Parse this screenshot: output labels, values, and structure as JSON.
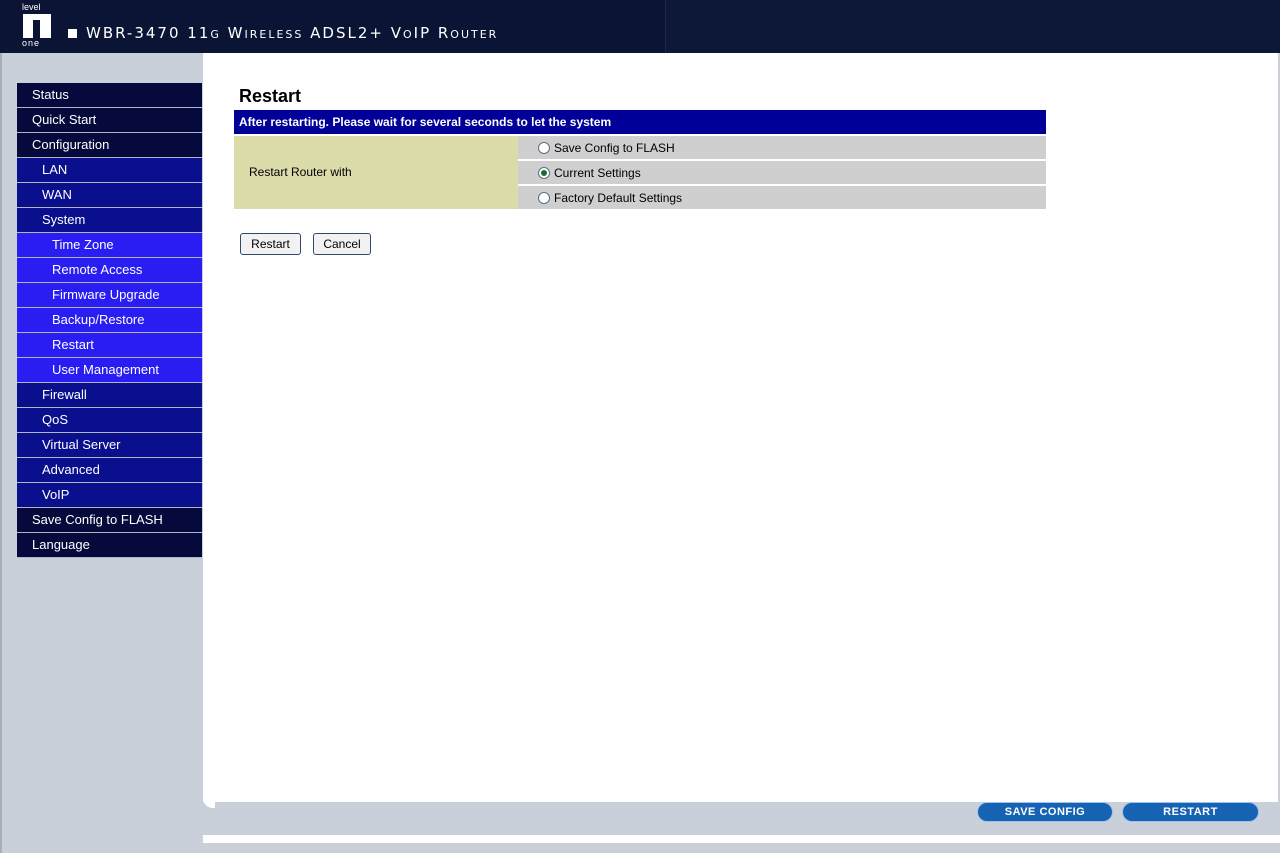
{
  "header": {
    "logo_top": "level",
    "logo_bottom": "one",
    "title": "WBR-3470 11g Wireless ADSL2+ VoIP Router"
  },
  "sidebar": {
    "items": [
      {
        "label": "Status",
        "level": 1
      },
      {
        "label": "Quick Start",
        "level": 1
      },
      {
        "label": "Configuration",
        "level": 1
      },
      {
        "label": "LAN",
        "level": 2
      },
      {
        "label": "WAN",
        "level": 2
      },
      {
        "label": "System",
        "level": 2
      },
      {
        "label": "Time Zone",
        "level": 3
      },
      {
        "label": "Remote Access",
        "level": 3
      },
      {
        "label": "Firmware Upgrade",
        "level": 3
      },
      {
        "label": "Backup/Restore",
        "level": 3
      },
      {
        "label": "Restart",
        "level": 3
      },
      {
        "label": "User Management",
        "level": 3
      },
      {
        "label": "Firewall",
        "level": 2
      },
      {
        "label": "QoS",
        "level": 2
      },
      {
        "label": "Virtual Server",
        "level": 2
      },
      {
        "label": "Advanced",
        "level": 2
      },
      {
        "label": "VoIP",
        "level": 2
      },
      {
        "label": "Save Config to FLASH",
        "level": 1
      },
      {
        "label": "Language",
        "level": 1
      }
    ]
  },
  "main": {
    "title": "Restart",
    "panel_header": "After restarting. Please wait for several seconds to let the system",
    "field_label": "Restart Router with",
    "options": [
      {
        "label": "Save Config to FLASH",
        "checked": false
      },
      {
        "label": "Current Settings",
        "checked": true
      },
      {
        "label": "Factory Default Settings",
        "checked": false
      }
    ],
    "restart_button": "Restart",
    "cancel_button": "Cancel"
  },
  "footer": {
    "save_config_button": "SAVE CONFIG",
    "restart_button": "RESTART"
  },
  "colors": {
    "header_bg": "#0b1434",
    "nav_level1": "#05093b",
    "nav_level2": "#0a0f8e",
    "nav_level3": "#2a1df2",
    "panel_header": "#000099",
    "label_cell": "#dcdcaa",
    "option_cell": "#cfcfcf",
    "footer_button": "#1763b3"
  }
}
